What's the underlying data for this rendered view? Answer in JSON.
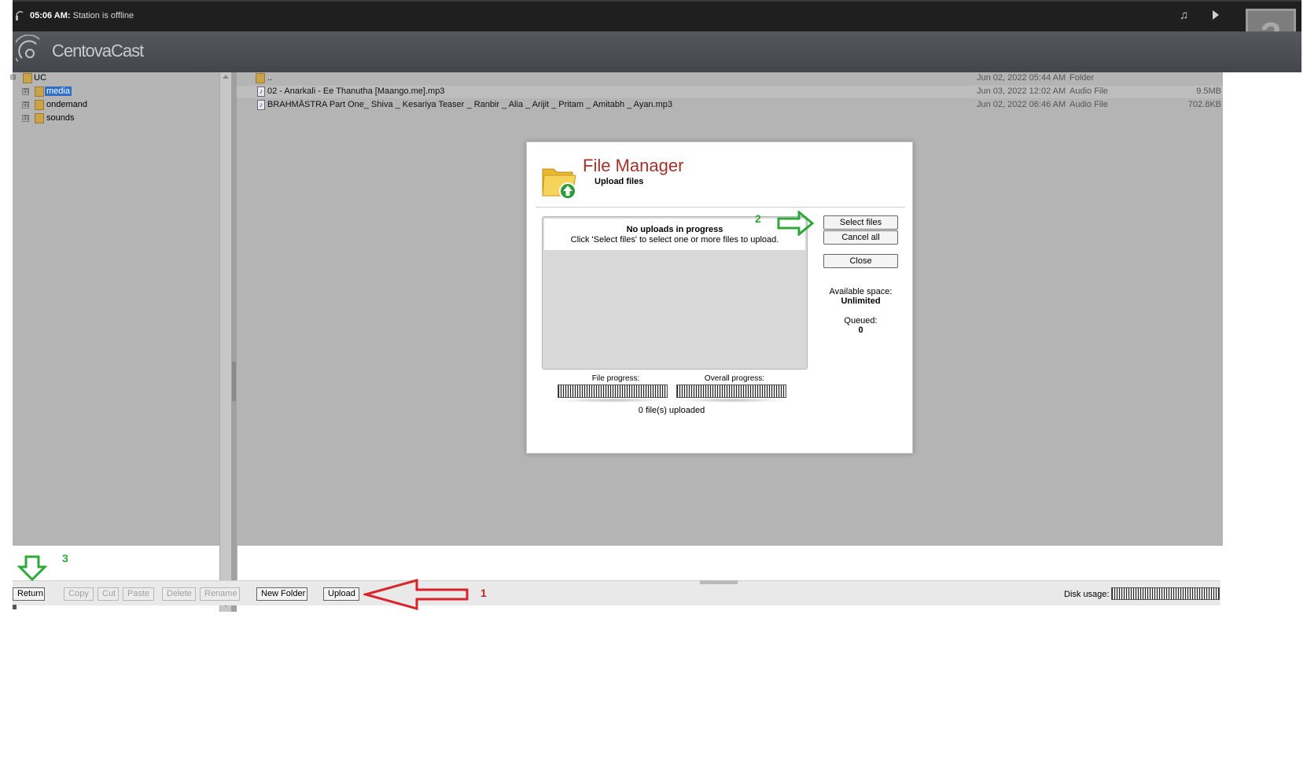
{
  "topbar": {
    "time": "05:06 AM:",
    "status": " Station is offline",
    "help_glyph": "?"
  },
  "logo": {
    "text": "CentovaCast"
  },
  "tree": {
    "items": [
      {
        "label": "UC",
        "expander": "⊟",
        "level": 0
      },
      {
        "label": "media",
        "expander": "⊞",
        "level": 1,
        "selected": true
      },
      {
        "label": "ondemand",
        "expander": "⊞",
        "level": 1
      },
      {
        "label": "sounds",
        "expander": "⊞",
        "level": 1
      }
    ]
  },
  "files": [
    {
      "name": "..",
      "date": "Jun 02, 2022 05:44 AM",
      "type": "Folder",
      "size": "",
      "icon": "folder-icon"
    },
    {
      "name": "02 - Anarkali - Ee Thanutha [Maango.me].mp3",
      "date": "Jun 03, 2022 12:02 AM",
      "type": "Audio File",
      "size": "9.5MB",
      "icon": "audio-file-icon"
    },
    {
      "name": "BRAHMĀSTRA Part One_ Shiva _ Kesariya Teaser _ Ranbir _ Alia _ Arijit _ Pritam _ Amitabh _ Ayan.mp3",
      "date": "Jun 02, 2022 06:46 AM",
      "type": "Audio File",
      "size": "702.8KB",
      "icon": "audio-file-icon"
    }
  ],
  "toolbar": {
    "return": "Return",
    "copy": "Copy",
    "cut": "Cut",
    "paste": "Paste",
    "delete": "Delete",
    "rename": "Rename",
    "new_folder": "New Folder",
    "upload": "Upload",
    "disk_usage": "Disk usage:"
  },
  "modal": {
    "title": "File Manager",
    "subtitle": "Upload files",
    "no_uploads": "No uploads in progress",
    "hint": "Click 'Select files' to select one or more files to upload.",
    "select_files": "Select files",
    "cancel_all": "Cancel all",
    "close": "Close",
    "available_label": "Available space:",
    "available_value": "Unlimited",
    "queued_label": "Queued:",
    "queued_value": "0",
    "file_progress": "File progress:",
    "overall_progress": "Overall progress:",
    "uploaded_count": "0 file(s) uploaded"
  },
  "annotations": {
    "step1": "1",
    "step2": "2",
    "step3": "3",
    "colors": {
      "red_arrow": "#d8242b",
      "green_arrow": "#2fa83a"
    }
  },
  "colors": {
    "title_red": "#a1332b",
    "selection_blue": "#2f6ec8",
    "pane_gray": "#b4b4b4"
  }
}
